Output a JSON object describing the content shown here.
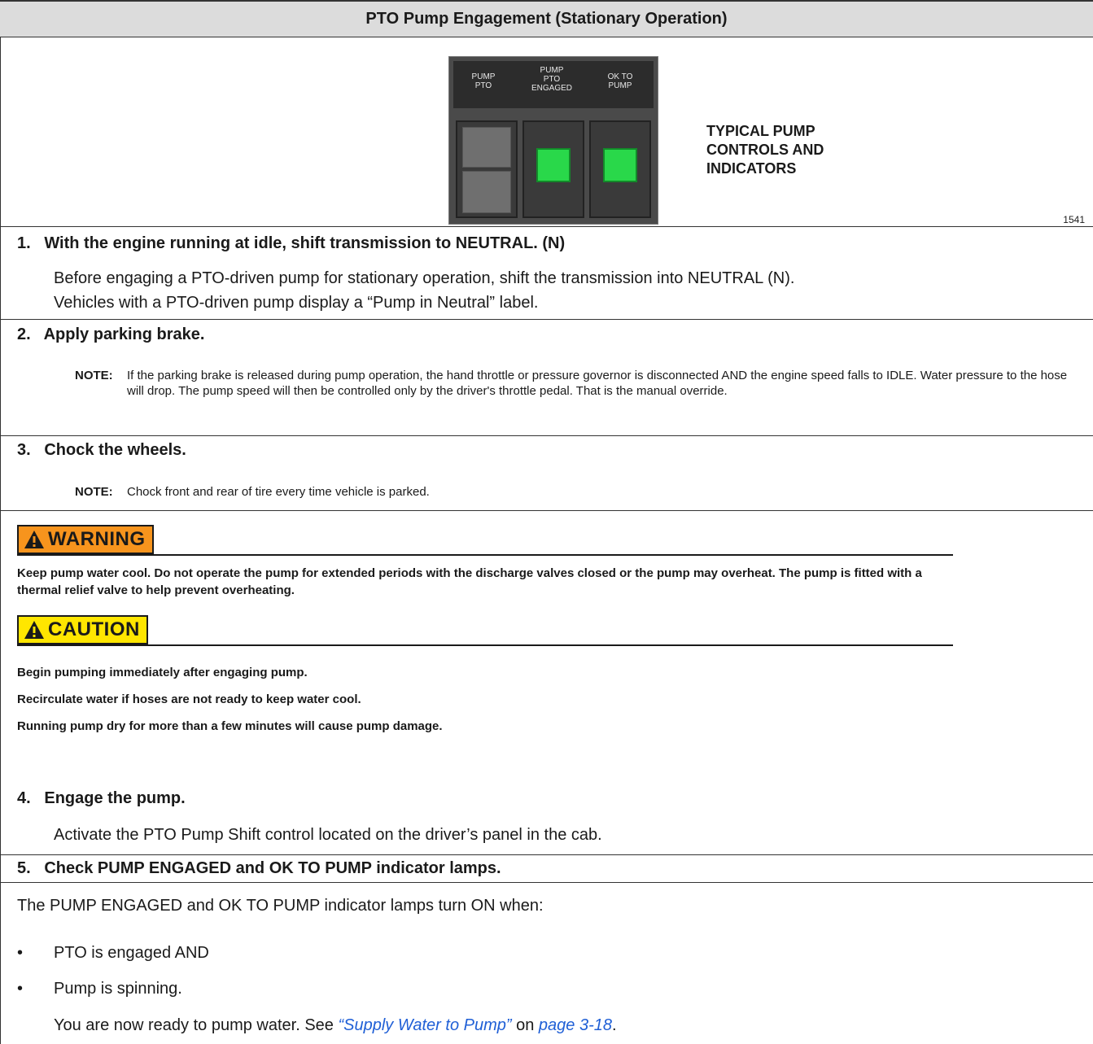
{
  "header": {
    "title": "PTO Pump Engagement (Stationary Operation)"
  },
  "figure": {
    "labels": [
      "PUMP\nPTO",
      "PUMP\nPTO\nENGAGED",
      "OK TO\nPUMP"
    ],
    "caption": [
      "TYPICAL PUMP",
      "CONTROLS AND",
      "INDICATORS"
    ],
    "number": "1541",
    "lamp_color": "#29d84a"
  },
  "steps": {
    "s1": {
      "title": "1.   With the engine running at idle, shift transmission to NEUTRAL. (N)",
      "body1": "Before engaging a PTO-driven pump for stationary operation, shift the transmission into NEUTRAL (N).",
      "body2": "Vehicles with a PTO-driven pump display a “Pump in Neutral” label."
    },
    "s2": {
      "title": "2.   Apply parking brake.",
      "note_label": "NOTE:",
      "note_text": "If the parking brake is released during pump operation, the hand throttle or pressure governor is disconnected AND the engine speed falls to IDLE. Water pressure to the hose will drop. The pump speed will then be controlled only by the driver's throttle pedal. That is the manual override."
    },
    "s3": {
      "title": "3.   Chock the wheels.",
      "note_label": "NOTE:",
      "note_text": "Chock front and rear of tire every time vehicle is parked."
    },
    "s4": {
      "title": "4.   Engage the pump.",
      "body": "Activate the PTO Pump Shift control located on the driver’s panel in the cab."
    },
    "s5": {
      "title": "5.   Check PUMP ENGAGED and OK TO PUMP indicator lamps.",
      "intro": "The PUMP ENGAGED and OK TO PUMP indicator lamps turn ON when:",
      "bullets": [
        "PTO is engaged AND",
        "Pump is spinning."
      ],
      "bullet_glyph": "•",
      "ready_prefix": "You are now ready to pump water. See ",
      "ready_link1": "“Supply Water to Pump”",
      "ready_mid": " on ",
      "ready_link2": "page 3-18",
      "ready_suffix": "."
    }
  },
  "warning": {
    "label": "WARNING",
    "color": "#f7941d",
    "text": "Keep pump water cool. Do not operate the pump for extended periods with the discharge valves closed or the pump may overheat. The pump is fitted with a thermal relief valve to help prevent overheating."
  },
  "caution": {
    "label": "CAUTION",
    "color": "#ffe600",
    "items": [
      "Begin pumping immediately after engaging pump.",
      "Recirculate water if hoses are not ready to keep water cool.",
      "Running pump dry for more than a few minutes will cause pump damage."
    ]
  }
}
